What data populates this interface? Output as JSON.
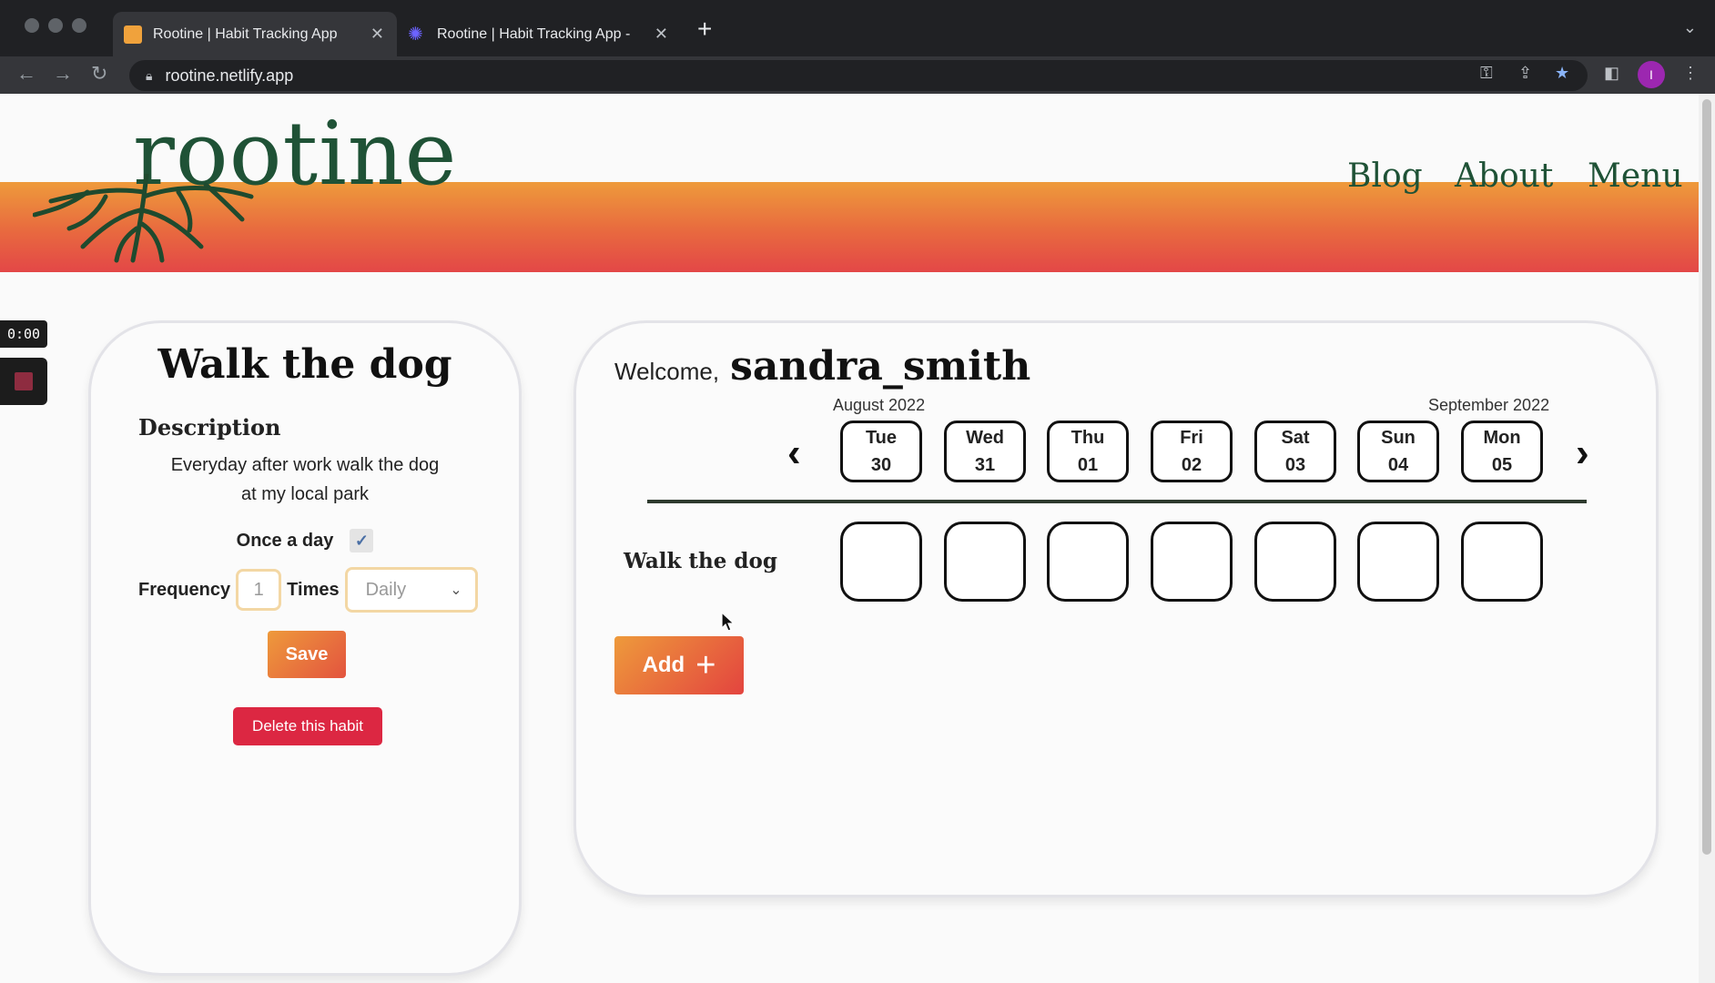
{
  "browser": {
    "tabs": [
      {
        "title": "Rootine | Habit Tracking App",
        "active": true
      },
      {
        "title": "Rootine | Habit Tracking App -",
        "active": false
      }
    ],
    "url": "rootine.netlify.app"
  },
  "header": {
    "logo": "rootine",
    "nav": [
      "Blog",
      "About",
      "Menu"
    ]
  },
  "recorder": {
    "time": "0:00"
  },
  "habit_card": {
    "title": "Walk the dog",
    "description_heading": "Description",
    "description_line1": "Everyday after work walk the dog",
    "description_line2": "at my local park",
    "once_a_day_label": "Once a day",
    "once_a_day_checked": true,
    "frequency_label": "Frequency",
    "frequency_value": "1",
    "times_label": "Times",
    "period_value": "Daily",
    "save_label": "Save",
    "delete_label": "Delete this habit"
  },
  "tracker": {
    "welcome_label": "Welcome,",
    "username": "sandra_smith",
    "month_left": "August 2022",
    "month_right": "September 2022",
    "days": [
      {
        "dow": "Tue",
        "date": "30"
      },
      {
        "dow": "Wed",
        "date": "31"
      },
      {
        "dow": "Thu",
        "date": "01"
      },
      {
        "dow": "Fri",
        "date": "02"
      },
      {
        "dow": "Sat",
        "date": "03"
      },
      {
        "dow": "Sun",
        "date": "04"
      },
      {
        "dow": "Mon",
        "date": "05"
      }
    ],
    "habits": [
      {
        "name": "Walk the dog",
        "completed": [
          false,
          false,
          false,
          false,
          false,
          false,
          false
        ]
      }
    ],
    "add_label": "Add"
  },
  "colors": {
    "brand_green": "#1f5236",
    "header_gradient_top": "#ee9a3b",
    "header_gradient_bottom": "#e34747",
    "delete_red": "#dc2742"
  }
}
